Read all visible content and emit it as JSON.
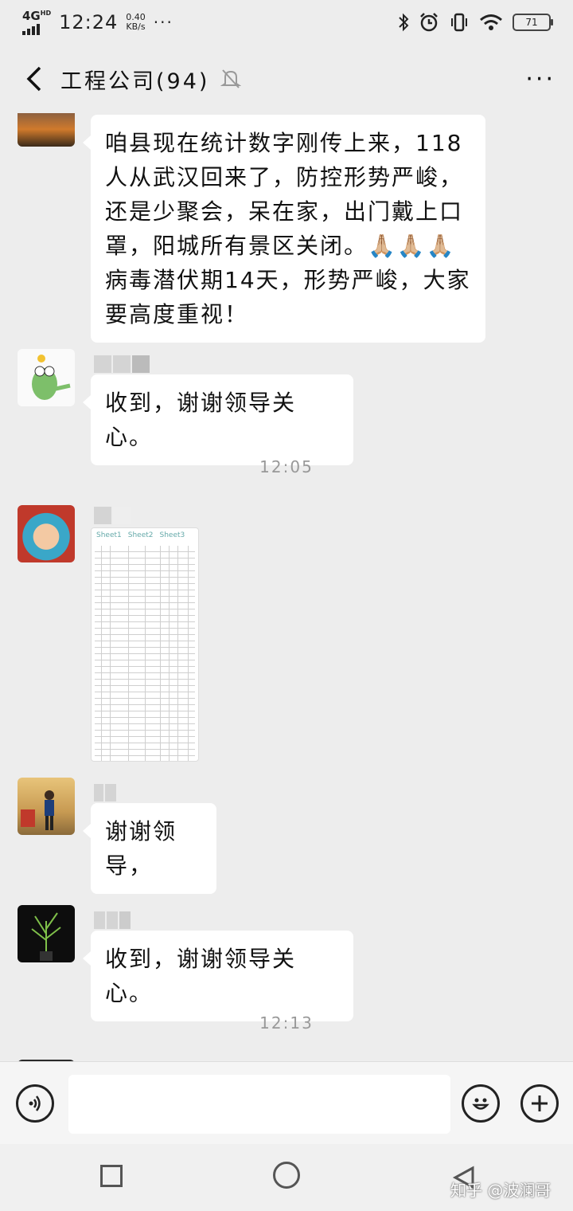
{
  "status_bar": {
    "network": "4G",
    "network_sup": "HD",
    "time": "12:24",
    "speed_value": "0.40",
    "speed_unit": "KB/s",
    "more_dots": "···",
    "battery": "71"
  },
  "header": {
    "back_icon": "chevron-left-icon",
    "title": "工程公司(94)",
    "mute_icon": "bell-mute-icon",
    "more": "···"
  },
  "messages": [
    {
      "type": "text",
      "text": "咱县现在统计数字刚传上来，118人从武汉回来了，防控形势严峻，还是少聚会，呆在家，出门戴上口罩，阳城所有景区关闭。🙏🏼🙏🏼🙏🏼病毒潜伏期14天，形势严峻，大家要高度重视！"
    },
    {
      "type": "text",
      "text": "收到，谢谢领导关心。"
    },
    {
      "type": "time",
      "text": "12:05"
    },
    {
      "type": "image",
      "sheet_tabs": [
        "Sheet1",
        "Sheet2",
        "Sheet3"
      ]
    },
    {
      "type": "text",
      "text": "谢谢领导，"
    },
    {
      "type": "text",
      "text": "收到，谢谢领导关心。"
    },
    {
      "type": "time",
      "text": "12:13"
    }
  ],
  "input_bar": {
    "voice_icon": "voice-icon",
    "emoji_icon": "emoji-icon",
    "plus_icon": "plus-icon",
    "input_value": ""
  },
  "system_nav": {
    "recent_icon": "square-icon",
    "home_icon": "circle-icon",
    "back_icon": "triangle-icon",
    "watermark": "知乎 @波澜哥"
  }
}
